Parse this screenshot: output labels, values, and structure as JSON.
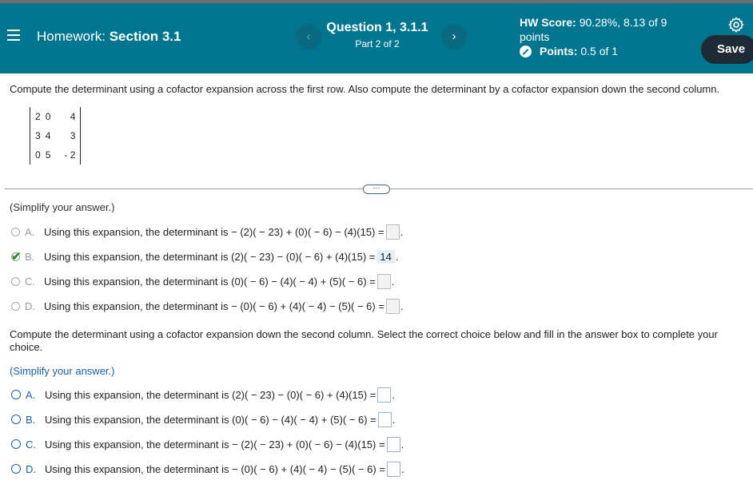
{
  "header": {
    "homework_label": "Homework:",
    "section_label": "Section 3.1",
    "question_title": "Question 1, 3.1.1",
    "question_part": "Part 2 of 2",
    "score_label": "HW Score:",
    "score_value": "90.28%, 8.13 of 9",
    "score_unit": "points",
    "points_label": "Points:",
    "points_value": "0.5 of 1",
    "save_label": "Save",
    "prev_glyph": "‹",
    "next_glyph": "›"
  },
  "problem": {
    "instruction": "Compute the determinant using a cofactor expansion across the first row. Also compute the determinant by a cofactor expansion down the second column.",
    "matrix": [
      [
        "2",
        "0",
        "4"
      ],
      [
        "3",
        "4",
        "3"
      ],
      [
        "0",
        "5",
        "- 2"
      ]
    ]
  },
  "divider_label": "⋯",
  "part1": {
    "simplify_cut": "(Simplify your answer.)",
    "options": [
      {
        "letter": "A.",
        "text": "Using this expansion, the determinant is  − (2)( − 23) + (0)( − 6) − (4)(15) =",
        "answer": ""
      },
      {
        "letter": "B.",
        "text": "Using this expansion, the determinant is (2)( − 23) − (0)( − 6) + (4)(15) =",
        "answer": "14"
      },
      {
        "letter": "C.",
        "text": "Using this expansion, the determinant is (0)( − 6) − (4)( − 4) + (5)( − 6) =",
        "answer": ""
      },
      {
        "letter": "D.",
        "text": "Using this expansion, the determinant is  − (0)( − 6) + (4)( − 4) − (5)( − 6) =",
        "answer": ""
      }
    ]
  },
  "part2": {
    "instruction": "Compute the determinant using a cofactor expansion down the second column. Select the correct choice below and fill in the answer box to complete your choice.",
    "simplify": "(Simplify your answer.)",
    "options": [
      {
        "letter": "A.",
        "text": "Using this expansion, the determinant is (2)( − 23) − (0)( − 6) + (4)(15) ="
      },
      {
        "letter": "B.",
        "text": "Using this expansion, the determinant is (0)( − 6) − (4)( − 4) + (5)( − 6) ="
      },
      {
        "letter": "C.",
        "text": "Using this expansion, the determinant is  − (2)( − 23) + (0)( − 6) − (4)(15) ="
      },
      {
        "letter": "D.",
        "text": "Using this expansion, the determinant is  − (0)( − 6) + (4)( − 4) − (5)( − 6) ="
      }
    ]
  },
  "colors": {
    "header": "#00758f",
    "save_button": "#1e2a36",
    "link_blue": "#1d5fa8",
    "check_green": "#2e8b2e"
  },
  "icons": [
    "menu-icon",
    "chevron-left-icon",
    "chevron-right-icon",
    "points-status-icon",
    "gear-icon",
    "checkmark-icon"
  ]
}
